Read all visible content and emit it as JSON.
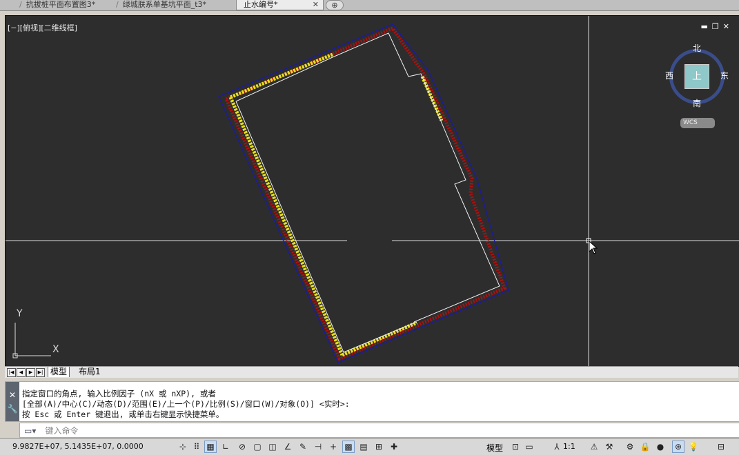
{
  "tabs": [
    {
      "label": "抗拔桩平面布置图3*",
      "active": false
    },
    {
      "label": "绿城朕系单基坑平面_t3*",
      "active": false
    },
    {
      "label": "止水编号*",
      "active": true
    }
  ],
  "viewport": {
    "label": "[−][俯视][二维线框]",
    "compass": {
      "north": "北",
      "south": "南",
      "west": "西",
      "east": "东",
      "cube": "上",
      "ucs": "WCS"
    },
    "axis": {
      "x": "X",
      "y": "Y"
    }
  },
  "layout_tabs": {
    "model": "模型",
    "layout1": "布局1"
  },
  "command": {
    "lines": [
      "指定窗口的角点, 输入比例因子 (nX 或 nXP), 或者",
      "[全部(A)/中心(C)/动态(D)/范围(E)/上一个(P)/比例(S)/窗口(W)/对象(O)] <实时>:",
      "按 Esc 或 Enter 键退出, 或单击右键显示快捷菜单。"
    ],
    "placeholder": "键入命令"
  },
  "status": {
    "coords": "9.9827E+07, 5.1435E+07, 0.0000",
    "model": "模型",
    "scale": "1:1"
  },
  "colors": {
    "canvas": "#2d2d2d",
    "outline": "#1a1aa8",
    "piles": "#b01010",
    "hatch": "#e8e020"
  }
}
